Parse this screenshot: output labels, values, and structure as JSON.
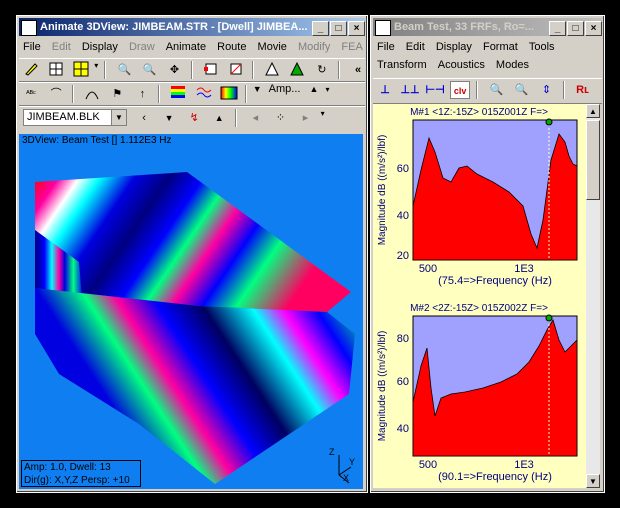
{
  "left_window": {
    "title": "Animate 3DView: JIMBEAM.STR - [Dwell] JIMBEA...",
    "menu": [
      {
        "label": "File",
        "enabled": true
      },
      {
        "label": "Edit",
        "enabled": false
      },
      {
        "label": "Display",
        "enabled": true
      },
      {
        "label": "Draw",
        "enabled": false
      },
      {
        "label": "Animate",
        "enabled": true
      },
      {
        "label": "Route",
        "enabled": true
      },
      {
        "label": "Movie",
        "enabled": true
      },
      {
        "label": "Modify",
        "enabled": false
      },
      {
        "label": "FEA",
        "enabled": false
      }
    ],
    "amp_label": "Amp...",
    "component_value": "JIMBEAM.BLK",
    "viewport_title": "3DView: Beam Test [] 1.112E3 Hz",
    "status_line1": "Amp: 1.0,  Dwell: 13",
    "status_line2": "Dir(g): X,Y,Z Persp: +10",
    "axis_labels": {
      "z": "Z",
      "y": "Y",
      "x": "X"
    },
    "colors": {
      "viewport_bg": "#0f7ef0",
      "shape_red": "#ff0000",
      "shape_magenta": "#ff00a0",
      "shape_green": "#00ff80",
      "shape_blue": "#0000e0"
    }
  },
  "right_window": {
    "title": "Beam Test, 33 FRFs, Ro=...",
    "menu_row1": [
      "File",
      "Edit",
      "Display",
      "Format",
      "Tools"
    ],
    "menu_row2": [
      "Transform",
      "Acoustics",
      "Modes"
    ],
    "plots": [
      {
        "header": "M#1 <1Z:-15Z> 015Z001Z F=>",
        "ylabel": "Magnitude dB ((m/s²)/lbf)",
        "yticks": [
          "60",
          "40",
          "20"
        ],
        "xticks": [
          "500",
          "1E3"
        ],
        "xlabel": "(75.4=>Frequency (Hz)"
      },
      {
        "header": "M#2 <2Z:-15Z> 015Z002Z F=>",
        "ylabel": "Magnitude dB ((m/s²)/lbf)",
        "yticks": [
          "80",
          "60",
          "40"
        ],
        "xticks": [
          "500",
          "1E3"
        ],
        "xlabel": "(90.1=>Frequency (Hz)"
      }
    ],
    "colors": {
      "plot_bg": "#a0a0ff",
      "fill": "#ff0000",
      "frame": "#ffffc0",
      "text": "#000080"
    }
  }
}
